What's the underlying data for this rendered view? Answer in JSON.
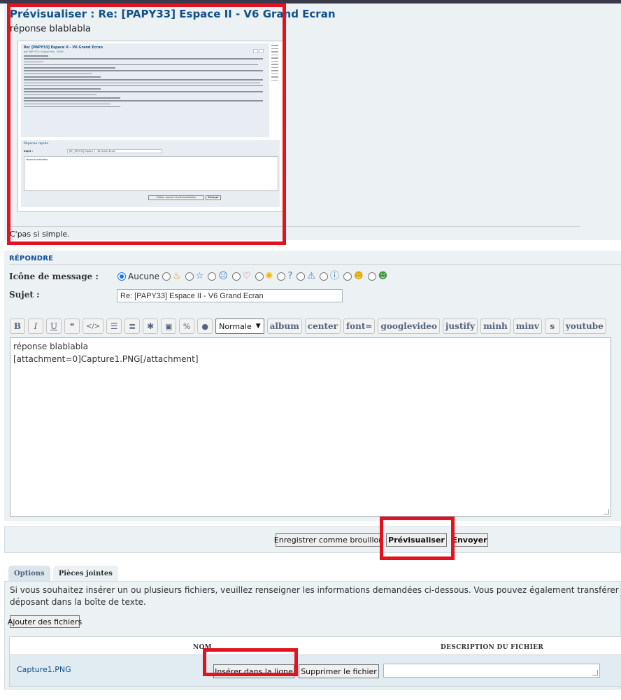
{
  "preview": {
    "title": "Prévisualiser : Re: [PAPY33] Espace II - V6 Grand Ecran",
    "body": "réponse blablabla",
    "signature": "C'pas si simple.",
    "screenshot": {
      "post_title": "Re: [PAPY33] Espace II - V6 Grand Ecran",
      "post_meta": "par PAPY33 » Aujourd'hui, 18:09",
      "quick_reply_title": "Réponse rapide",
      "subject_label": "Sujet :",
      "subject_value": "Re: [PAPY33] Espace II - V6 Grand Ecran",
      "textarea_value": "réponse blablabla",
      "btn_full_editor": "Éditeur avancé et prévisualisation",
      "btn_send": "Envoyer"
    }
  },
  "reply": {
    "header": "RÉPONDRE",
    "icon_label": "Icône de message :",
    "icon_none": "Aucune",
    "icons": [
      "fire-icon",
      "star-icon",
      "surprised-icon",
      "heart-icon",
      "idea-icon",
      "question-icon",
      "warning-icon",
      "info-icon",
      "wink-icon",
      "grin-icon"
    ],
    "subject_label": "Sujet :",
    "subject_value": "Re: [PAPY33] Espace II - V6 Grand Ecran",
    "toolbar": {
      "bold": "B",
      "italic": "I",
      "underline": "U",
      "font_size": "Normale",
      "custom": [
        "album",
        "center",
        "font=",
        "googlevideo",
        "justify",
        "minh",
        "minv",
        "s",
        "youtube"
      ]
    },
    "message": "réponse blablabla\n[attachment=0]Capture1.PNG[/attachment]"
  },
  "actions": {
    "save_draft": "Enregistrer comme brouillon",
    "preview": "Prévisualiser",
    "send": "Envoyer"
  },
  "tabs": {
    "options": "Options",
    "attachments": "Pièces jointes"
  },
  "attachments": {
    "info_line1": "Si vous souhaitez insérer un ou plusieurs fichiers, veuillez renseigner les informations demandées ci-dessous. Vous pouvez également transférer des fichiers en les",
    "info_line2": "déposant dans la boîte de texte.",
    "add_files": "Ajouter des fichiers",
    "col_name": "NOM",
    "col_desc": "DESCRIPTION DU FICHIER",
    "file_name": "Capture1.PNG",
    "insert_inline": "Insérer dans la ligne",
    "delete_file": "Supprimer le fichier"
  },
  "colors": {
    "highlight": "#e3121f",
    "panel": "#ecf1f3",
    "title": "#105289"
  }
}
